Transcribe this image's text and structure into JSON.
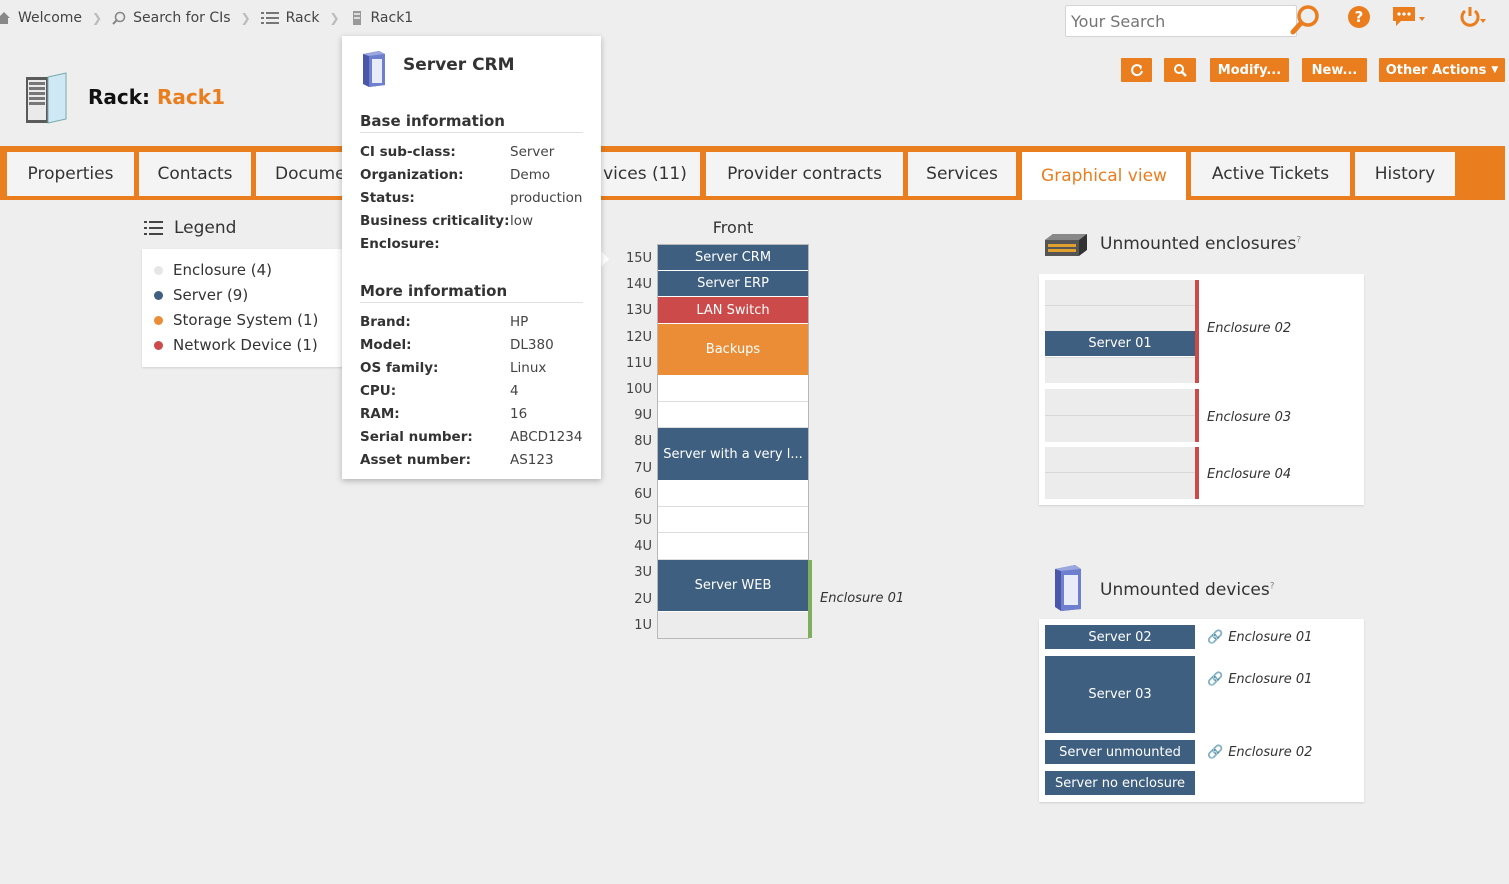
{
  "breadcrumb": {
    "items": [
      {
        "label": "Welcome",
        "icon": "home-icon"
      },
      {
        "label": "Search for CIs",
        "icon": "search-icon"
      },
      {
        "label": "Rack",
        "icon": "list-icon"
      },
      {
        "label": "Rack1",
        "icon": "rack-icon"
      }
    ]
  },
  "topbar": {
    "search_placeholder": "Your Search"
  },
  "actions": {
    "refresh": "⟳",
    "search": "🔍",
    "modify": "Modify...",
    "new": "New...",
    "other": "Other Actions"
  },
  "header": {
    "prefix": "Rack: ",
    "name": "Rack1"
  },
  "tabs": [
    {
      "label": "Properties"
    },
    {
      "label": "Contacts"
    },
    {
      "label": "Docume"
    },
    {
      "label": "vices (11)"
    },
    {
      "label": "Provider contracts"
    },
    {
      "label": "Services"
    },
    {
      "label": "Graphical view",
      "active": true
    },
    {
      "label": "Active Tickets"
    },
    {
      "label": "History"
    }
  ],
  "legend": {
    "title": "Legend",
    "items": [
      {
        "label": "Enclosure (4)",
        "color": "#e6e6e6"
      },
      {
        "label": "Server (9)",
        "color": "#3e5f80"
      },
      {
        "label": "Storage System (1)",
        "color": "#ea8d36"
      },
      {
        "label": "Network Device (1)",
        "color": "#cc4a4a"
      }
    ]
  },
  "rack": {
    "front_title": "Front",
    "units": [
      "15U",
      "14U",
      "13U",
      "12U",
      "11U",
      "10U",
      "9U",
      "8U",
      "7U",
      "6U",
      "5U",
      "4U",
      "3U",
      "2U",
      "1U"
    ],
    "devices": [
      {
        "label": "Server CRM",
        "color": "#3e5f80"
      },
      {
        "label": "Server ERP",
        "color": "#3e5f80"
      },
      {
        "label": "LAN Switch",
        "color": "#cc4a4a"
      },
      {
        "label": "Backups",
        "color": "#ea8d36"
      },
      {
        "label": "Server with a very l...",
        "color": "#3e5f80"
      },
      {
        "label": "Server WEB",
        "color": "#3e5f80"
      }
    ],
    "enclosure_label": "Enclosure 01",
    "enclosure_color": "#7fae5c"
  },
  "unmounted_enclosures": {
    "title": "Unmounted enclosures",
    "help": "?",
    "items": [
      {
        "label": "Enclosure 02",
        "server": "Server 01"
      },
      {
        "label": "Enclosure 03"
      },
      {
        "label": "Enclosure 04"
      }
    ],
    "bar_color": "#cc4a4a"
  },
  "unmounted_devices": {
    "title": "Unmounted devices",
    "help": "?",
    "items": [
      {
        "label": "Server 02",
        "link": "Enclosure 01"
      },
      {
        "label": "Server 03",
        "link": "Enclosure 01"
      },
      {
        "label": "Server unmounted",
        "link": "Enclosure 02"
      },
      {
        "label": "Server no enclosure",
        "link": ""
      }
    ]
  },
  "popup": {
    "title": "Server CRM",
    "base_title": "Base information",
    "base": [
      {
        "k": "CI sub-class:",
        "v": "Server"
      },
      {
        "k": "Organization:",
        "v": "Demo"
      },
      {
        "k": "Status:",
        "v": "production"
      },
      {
        "k": "Business criticality:",
        "v": "low"
      },
      {
        "k": "Enclosure:",
        "v": ""
      }
    ],
    "more_title": "More information",
    "more": [
      {
        "k": "Brand:",
        "v": "HP"
      },
      {
        "k": "Model:",
        "v": "DL380"
      },
      {
        "k": "OS family:",
        "v": "Linux"
      },
      {
        "k": "CPU:",
        "v": "4"
      },
      {
        "k": "RAM:",
        "v": "16"
      },
      {
        "k": "Serial number:",
        "v": "ABCD1234"
      },
      {
        "k": "Asset number:",
        "v": "AS123"
      }
    ]
  },
  "colors": {
    "accent": "#ea7d1e",
    "server": "#3e5f80"
  }
}
